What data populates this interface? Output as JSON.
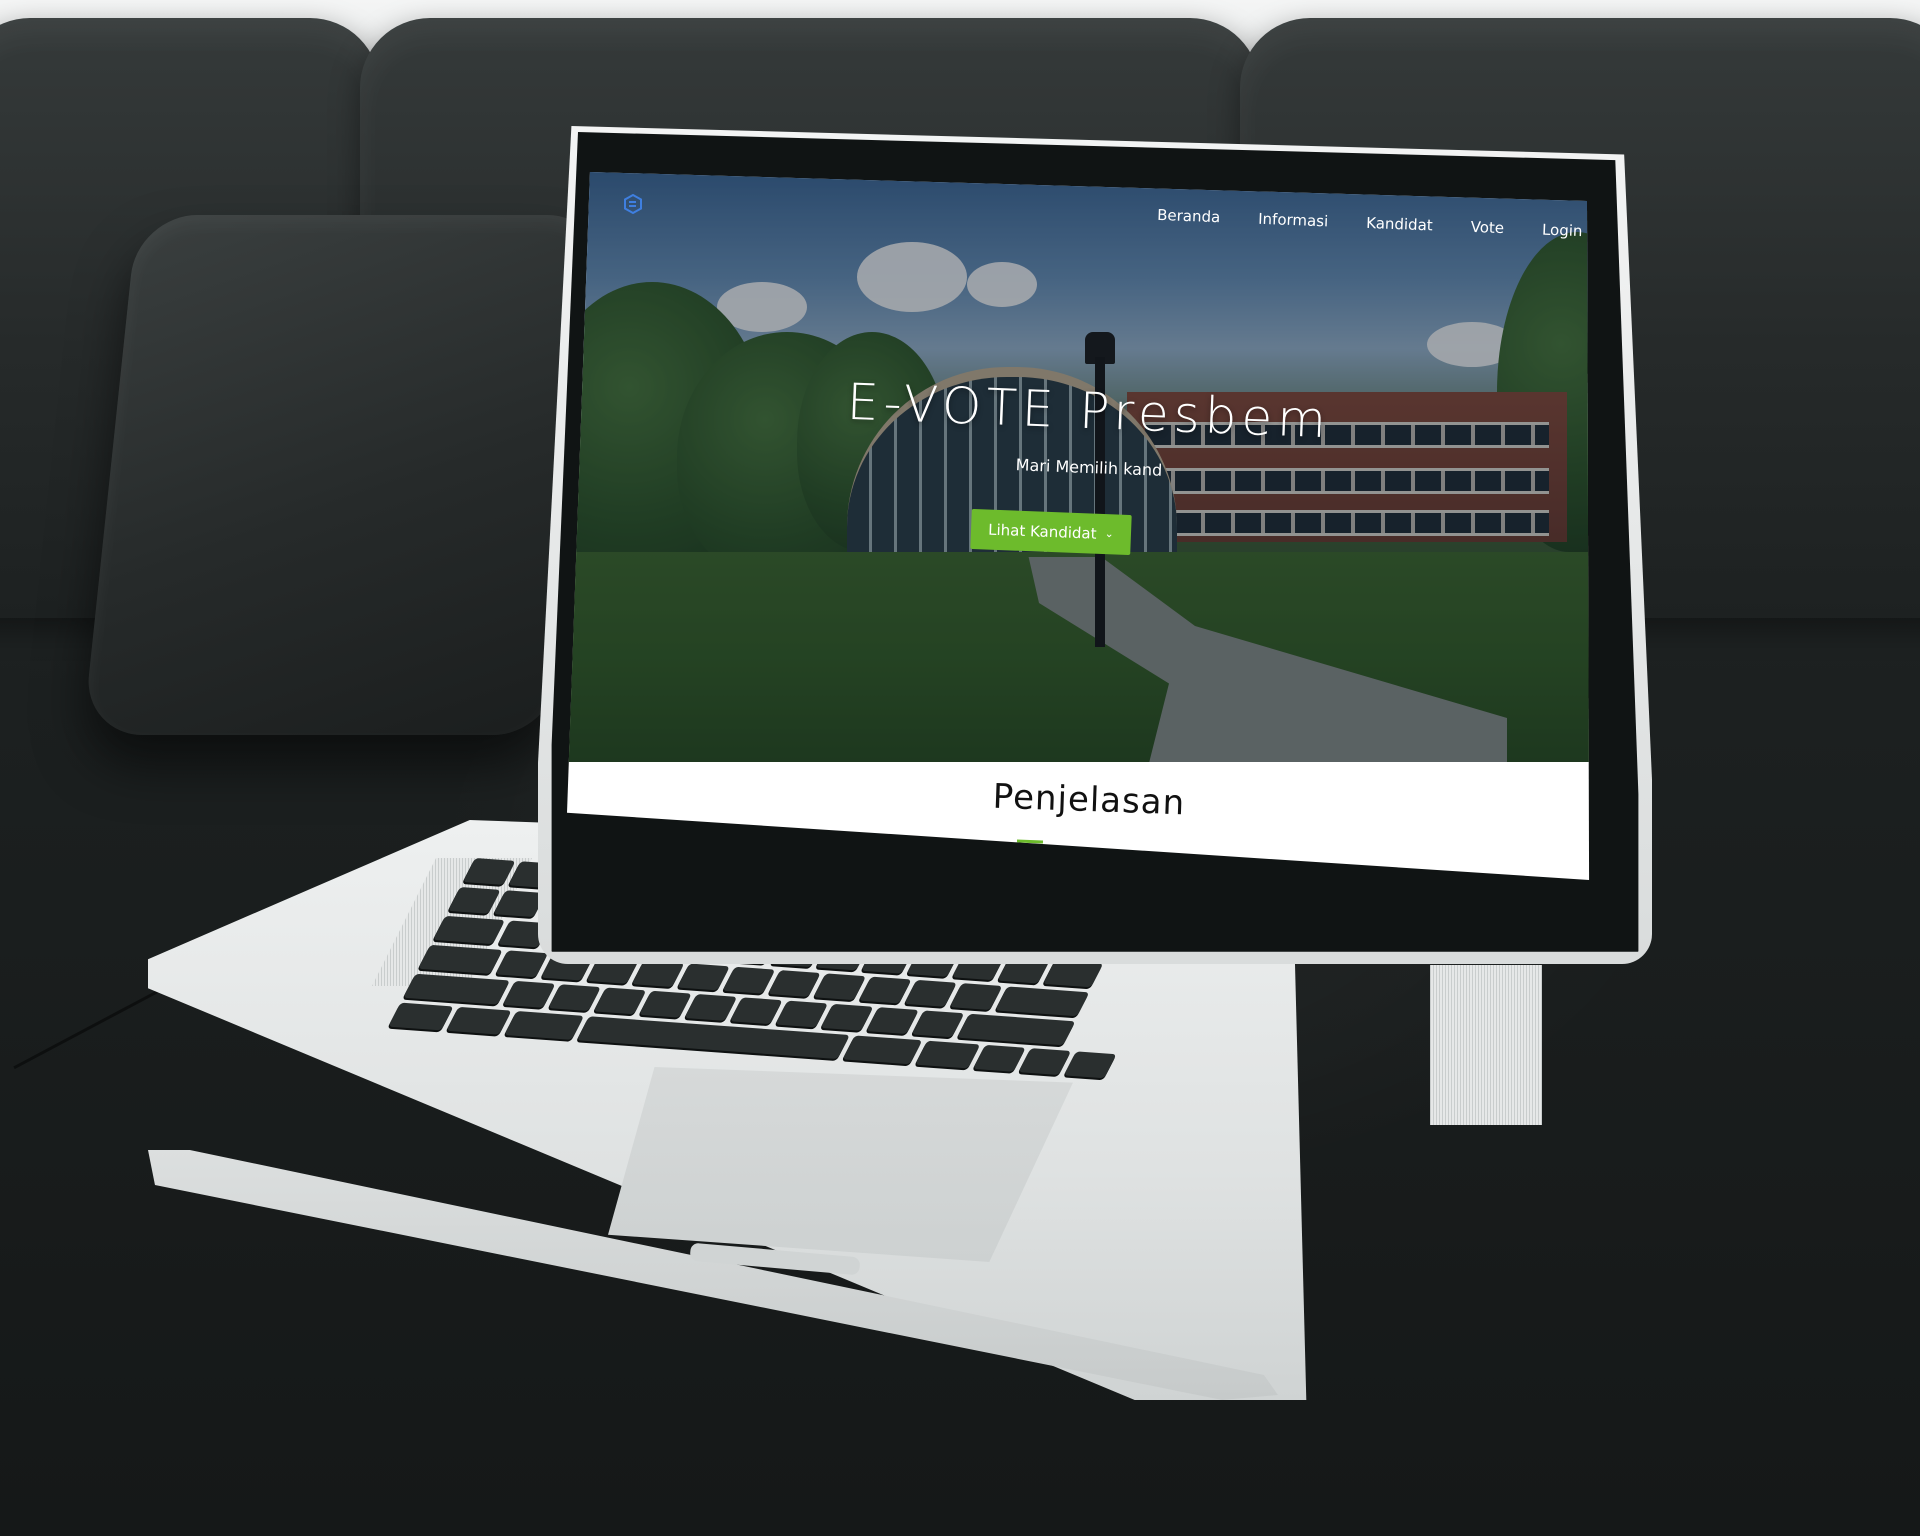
{
  "site": {
    "nav": {
      "items": [
        "Beranda",
        "Informasi",
        "Kandidat",
        "Vote",
        "Login"
      ]
    },
    "hero": {
      "title": "E-VOTE Presbem",
      "subtitle": "Mari Memilih kand",
      "button_label": "Lihat Kandidat",
      "button_icon": "chevron-down-icon"
    },
    "section": {
      "title": "Penjelasan"
    },
    "colors": {
      "accent": "#6dbb2c",
      "nav_text": "#ffffff",
      "section_title": "#111111"
    }
  }
}
